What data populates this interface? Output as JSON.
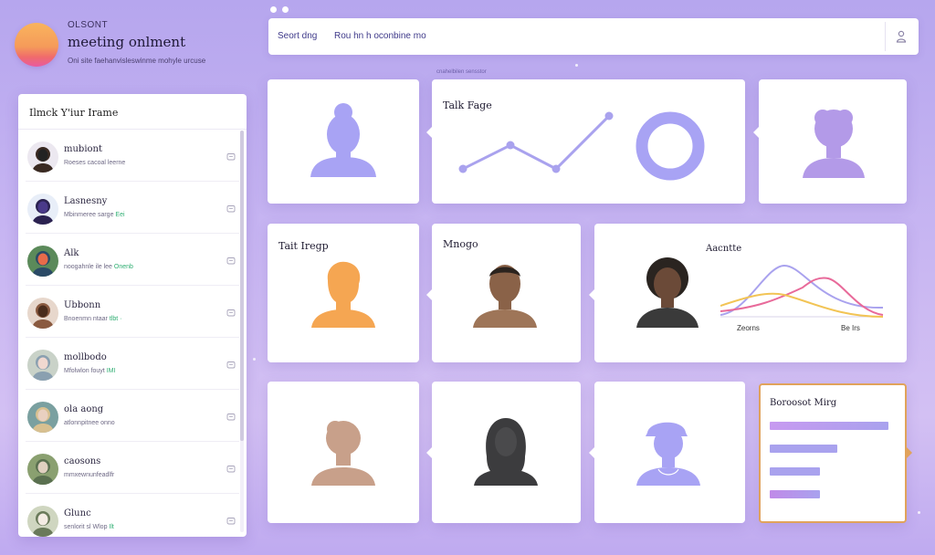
{
  "brand": {
    "small": "OLSONT",
    "title": "meeting onlment",
    "subtitle": "Oni site faehanvisleswinme mohyle urcuse"
  },
  "search": {
    "link1": "Seort dng",
    "link2": "Rou hn h oconbine mo",
    "user_icon": "user-icon"
  },
  "strip_caption": "cnahelbilen sensstor",
  "contacts": {
    "title": "Ilmck Y'iur Irame",
    "items": [
      {
        "name": "mubiont",
        "sub": "Roeses cacoal leerne",
        "tag": "",
        "avatar": "dark-hair"
      },
      {
        "name": "Lasnesny",
        "sub": "Mbinmeree sarge",
        "tag": "Eei",
        "avatar": "figure-dark"
      },
      {
        "name": "Alk",
        "sub": "noogahnle ile lee",
        "tag": "Onenb",
        "avatar": "scenery"
      },
      {
        "name": "Ubbonn",
        "sub": "Bnoenmn ntaar",
        "tag": "tlbt ·",
        "avatar": "brown-hair"
      },
      {
        "name": "mollbodo",
        "sub": "Mfolwlon fouyt",
        "tag": "IMI",
        "avatar": "sitting"
      },
      {
        "name": "ola aong",
        "sub": "atlonnpitnee onno",
        "tag": "",
        "avatar": "blonde"
      },
      {
        "name": "caosons",
        "sub": "mmxewnunfeadlfr",
        "tag": "",
        "avatar": "outdoor"
      },
      {
        "name": "Glunc",
        "sub": "senlorit sl Wlop",
        "tag": "Ilt",
        "avatar": "fair"
      }
    ]
  },
  "cards": {
    "line_card_label": "Talk Fage",
    "orange_card_label": "Tait Iregp",
    "man_card_label": "Mnogo",
    "analytics_label": "Aacntte",
    "axis_left": "Zeorns",
    "axis_right": "Be Irs",
    "feature_label": "Boroosot Mirg"
  },
  "colors": {
    "accent": "#9b93f2",
    "orange": "#f5a652",
    "highlight_border": "#e1a35b",
    "line_pink": "#e86a9a",
    "line_yellow": "#f2c455"
  },
  "feature_bars": [
    0.93,
    0.53,
    0.39,
    0.39
  ]
}
